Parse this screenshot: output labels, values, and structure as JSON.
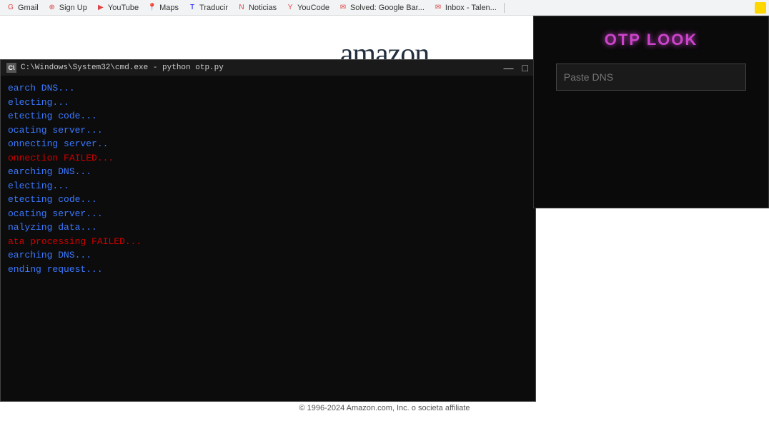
{
  "browser": {
    "tabs": [
      {
        "id": "gmail",
        "label": "Gmail",
        "icon": "G"
      },
      {
        "id": "signup",
        "label": "Sign Up",
        "icon": "S"
      },
      {
        "id": "youtube",
        "label": "YouTube",
        "icon": "▶"
      },
      {
        "id": "maps",
        "label": "Maps",
        "icon": "M"
      },
      {
        "id": "traducir",
        "label": "Traducir",
        "icon": "T"
      },
      {
        "id": "noticias",
        "label": "Noticias",
        "icon": "N"
      },
      {
        "id": "youcode",
        "label": "YouCode",
        "icon": "Y"
      },
      {
        "id": "solved",
        "label": "Solved: Google Bar...",
        "icon": "S"
      },
      {
        "id": "inbox",
        "label": "Inbox - Talen...",
        "icon": "I"
      }
    ]
  },
  "amazon": {
    "logo_text": "amazon",
    "arrow": "↗",
    "footer": "© 1996-2024 Amazon.com, Inc. o societa affiliate"
  },
  "cmd": {
    "title": "C:\\Windows\\System32\\cmd.exe - python  otp.py",
    "lines": [
      {
        "text": "earch DNS...",
        "color": "blue"
      },
      {
        "text": "electing...",
        "color": "blue"
      },
      {
        "text": "etecting code...",
        "color": "blue"
      },
      {
        "text": "ocating server...",
        "color": "blue"
      },
      {
        "text": "onnecting server..",
        "color": "blue"
      },
      {
        "text": "onnection FAILED...",
        "color": "red"
      },
      {
        "text": "earching DNS...",
        "color": "blue"
      },
      {
        "text": "electing...",
        "color": "blue"
      },
      {
        "text": "etecting code...",
        "color": "blue"
      },
      {
        "text": "ocating server...",
        "color": "blue"
      },
      {
        "text": "nalyzing data...",
        "color": "blue"
      },
      {
        "text": "ata processing FAILED...",
        "color": "red"
      },
      {
        "text": "earching DNS...",
        "color": "blue"
      },
      {
        "text": "ending request...",
        "color": "blue"
      }
    ],
    "controls": {
      "minimize": "—",
      "maximize": "□"
    }
  },
  "otp": {
    "title": "OTP LOOK",
    "input_placeholder": "Paste DNS"
  }
}
